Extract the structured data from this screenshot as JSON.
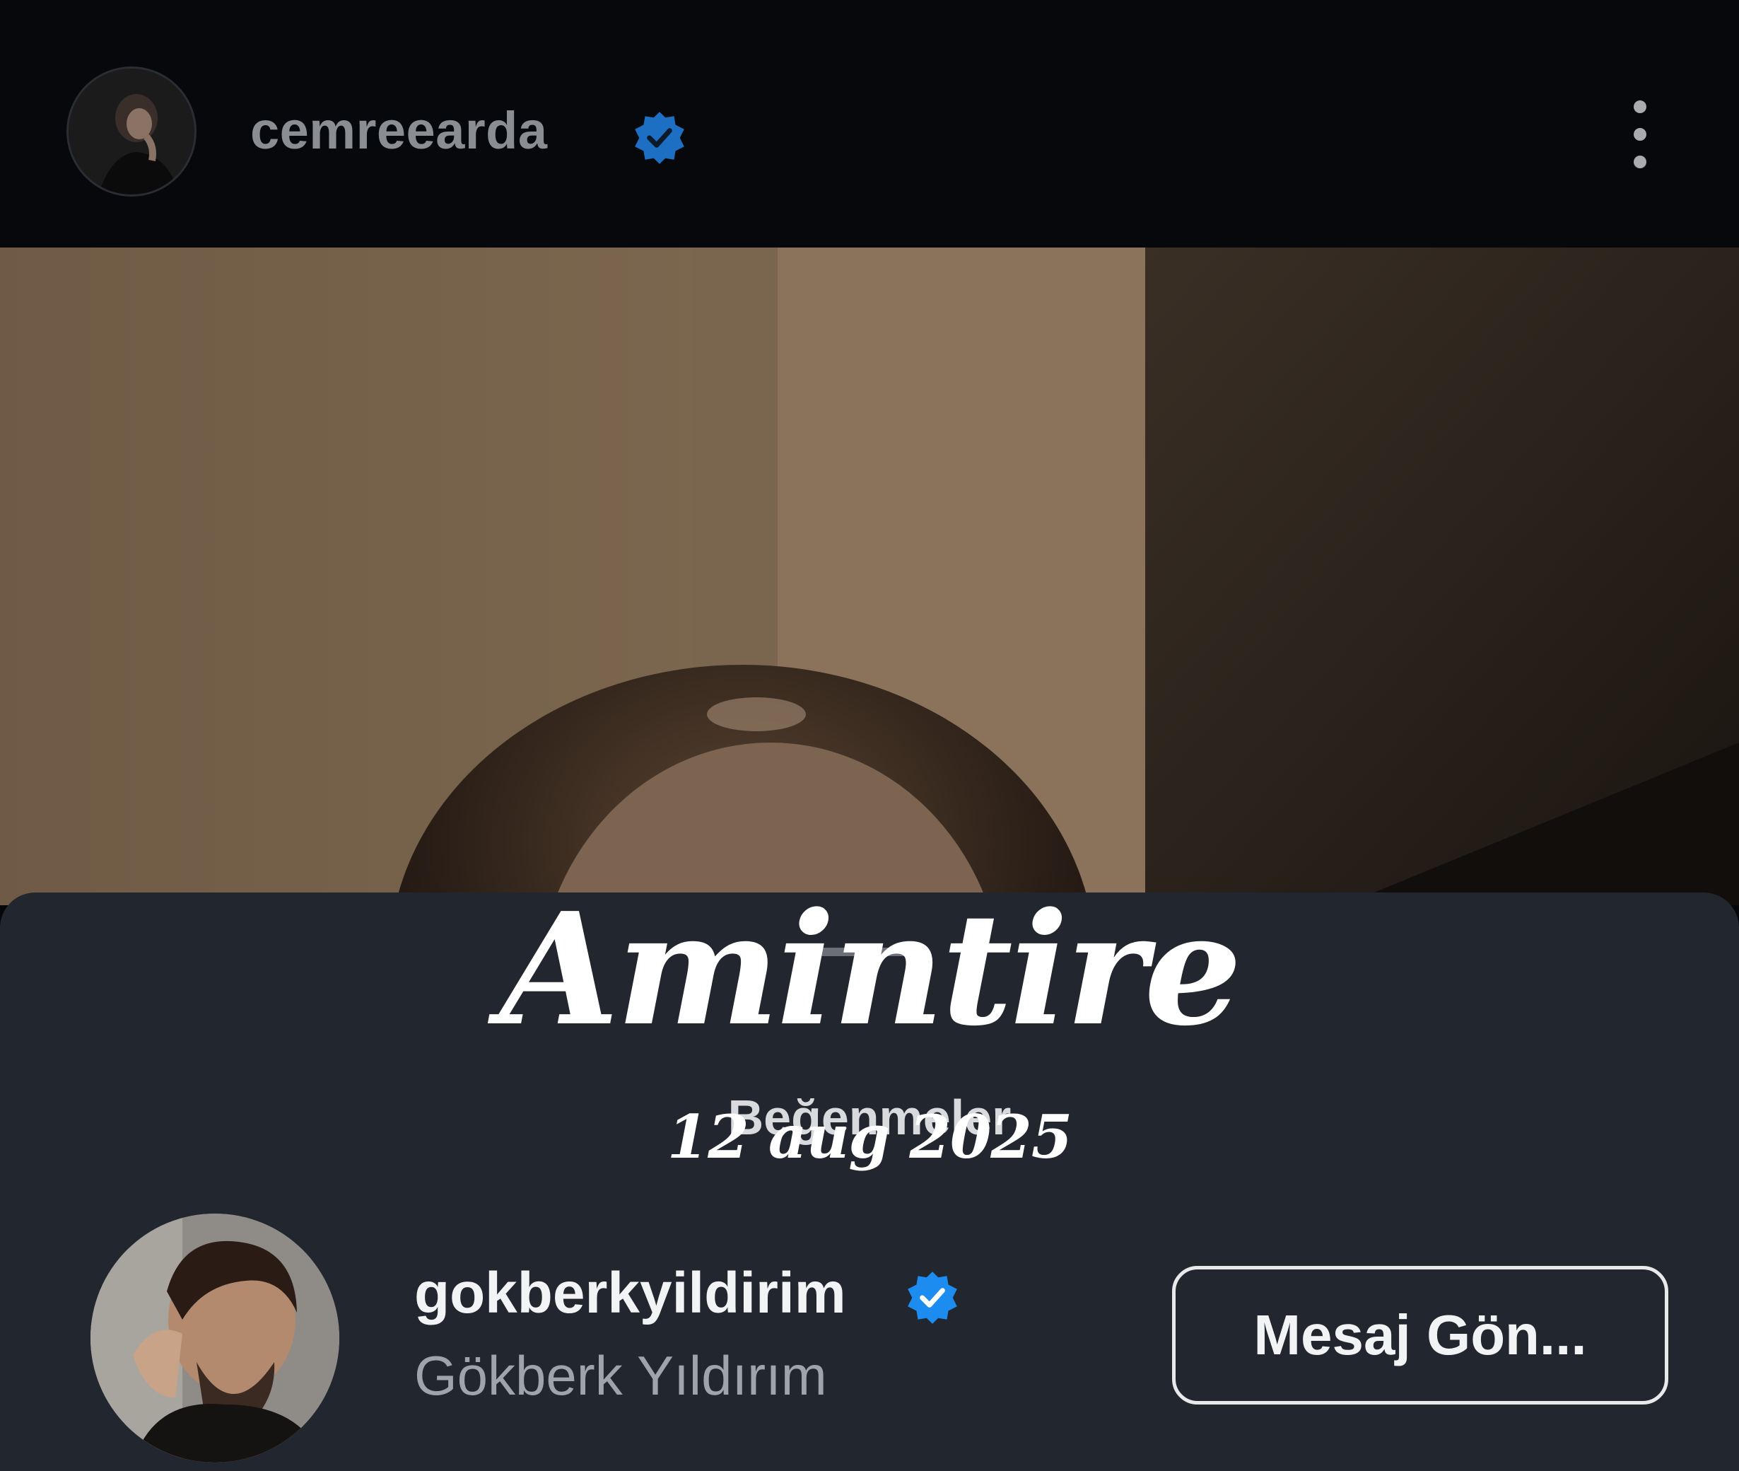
{
  "post": {
    "username": "cemreearda",
    "verified": true
  },
  "overlay": {
    "watermark": "Amintire",
    "date": "12 aug 2025"
  },
  "likes_sheet": {
    "title": "Beğenmeler",
    "user": {
      "username": "gokberkyildirim",
      "full_name": "Gökberk Yıldırım",
      "verified": true,
      "action_label": "Mesaj Gön..."
    }
  },
  "colors": {
    "background": "#05070b",
    "sheet": "#22262e",
    "verified_badge": "#1d8cf0"
  },
  "icons": {
    "verified": "verified-badge-icon",
    "more": "more-vertical-icon"
  }
}
